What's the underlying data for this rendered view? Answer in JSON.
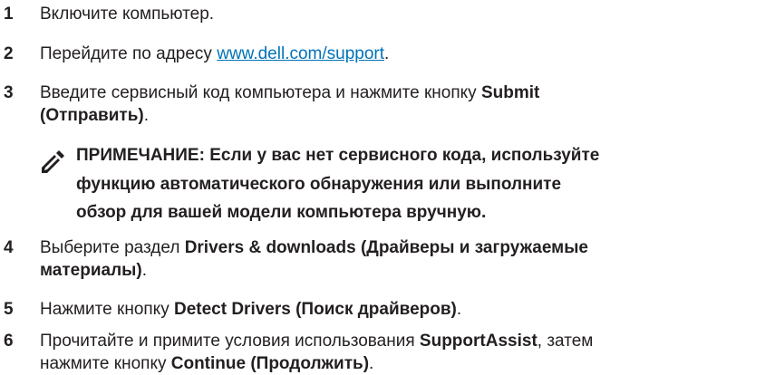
{
  "steps": [
    {
      "num": "1",
      "text": "Включите компьютер."
    },
    {
      "num": "2",
      "text_before": "Перейдите по адресу ",
      "link": "www.dell.com/support",
      "text_after": "."
    },
    {
      "num": "3",
      "line1_text": "Введите сервисный код компьютера и нажмите кнопку ",
      "line1_bold": "Submit",
      "line2_bold": "(Отправить)",
      "line2_after": "."
    },
    {
      "num": "4",
      "text": "Выберите раздел ",
      "bold1": "Drivers & downloads (Драйверы и загружаемые",
      "bold2": "материалы)",
      "after": "."
    },
    {
      "num": "5",
      "text": "Нажмите кнопку ",
      "bold": "Detect Drivers (Поиск драйверов)",
      "after": "."
    },
    {
      "num": "6",
      "line1_text": "Прочитайте и примите условия использования ",
      "line1_bold": "SupportAssist",
      "line1_after": ", затем",
      "line2_text": "нажмите кнопку ",
      "line2_bold": "Continue (Продолжить)",
      "line2_after": "."
    }
  ],
  "note": {
    "icon": "pencil-note-icon",
    "line1": "ПРИМЕЧАНИЕ: Если у вас нет сервисного кода, используйте",
    "line2": "функцию автоматического обнаружения или выполните",
    "line3": "обзор для вашей модели компьютера вручную."
  },
  "colors": {
    "text": "#231f20",
    "link": "#0073b9"
  }
}
